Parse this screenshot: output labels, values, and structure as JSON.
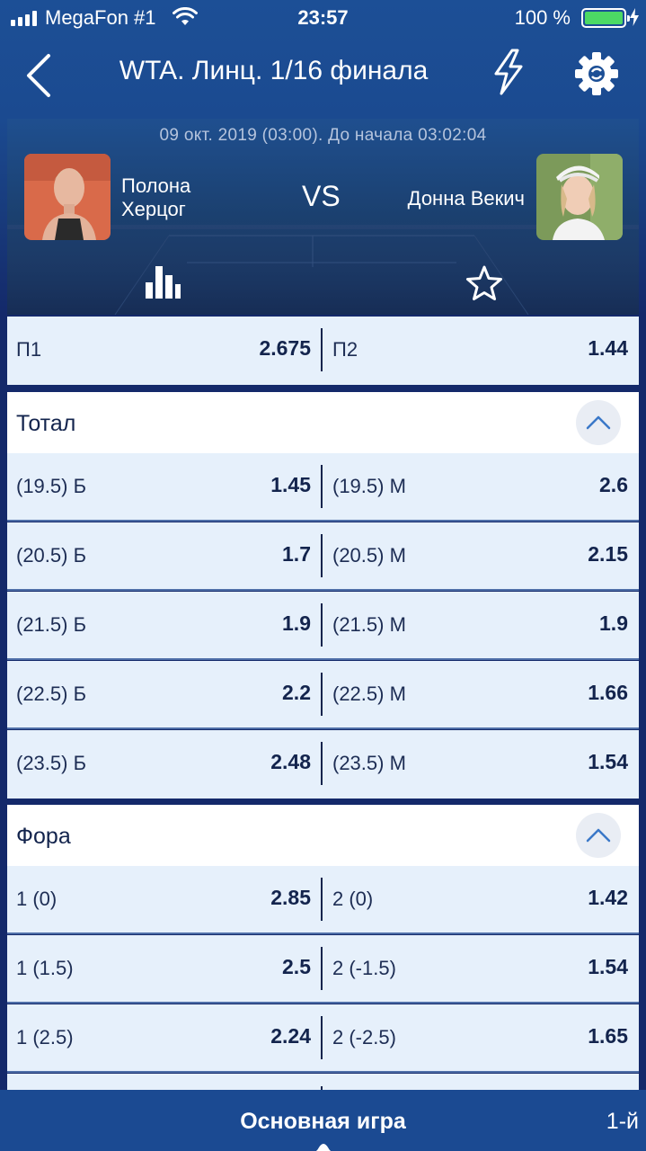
{
  "status_bar": {
    "carrier": "MegaFon #1",
    "time": "23:57",
    "battery": "100 %"
  },
  "header": {
    "title": "WTA. Линц. 1/16 финала"
  },
  "match": {
    "datetime": "09 окт. 2019 (03:00). До начала   03:02:04",
    "player1": "Полона Херцог",
    "player2": "Донна Векич",
    "vs": "VS"
  },
  "winner": {
    "left_label": "П1",
    "left_odd": "2.675",
    "right_label": "П2",
    "right_odd": "1.44"
  },
  "total": {
    "title": "Тотал",
    "rows": [
      {
        "left_label": "(19.5) Б",
        "left_odd": "1.45",
        "right_label": "(19.5) М",
        "right_odd": "2.6"
      },
      {
        "left_label": "(20.5) Б",
        "left_odd": "1.7",
        "right_label": "(20.5) М",
        "right_odd": "2.15"
      },
      {
        "left_label": "(21.5) Б",
        "left_odd": "1.9",
        "right_label": "(21.5) М",
        "right_odd": "1.9"
      },
      {
        "left_label": "(22.5) Б",
        "left_odd": "2.2",
        "right_label": "(22.5) М",
        "right_odd": "1.66"
      },
      {
        "left_label": "(23.5) Б",
        "left_odd": "2.48",
        "right_label": "(23.5) М",
        "right_odd": "1.54"
      }
    ]
  },
  "handicap": {
    "title": "Фора",
    "rows": [
      {
        "left_label": "1 (0)",
        "left_odd": "2.85",
        "right_label": "2 (0)",
        "right_odd": "1.42"
      },
      {
        "left_label": "1 (1.5)",
        "left_odd": "2.5",
        "right_label": "2 (-1.5)",
        "right_odd": "1.54"
      },
      {
        "left_label": "1 (2.5)",
        "left_odd": "2.24",
        "right_label": "2 (-2.5)",
        "right_odd": "1.65"
      }
    ]
  },
  "bottom_tabs": {
    "main": "Основная игра",
    "next": "1-й"
  },
  "colors": {
    "brand_blue": "#1b4a92",
    "row_bg": "#e6f0fb",
    "text_dark": "#13244d",
    "battery_green": "#4cd964"
  },
  "icons": [
    "back-chevron-icon",
    "lightning-icon",
    "gear-icon",
    "bar-chart-icon",
    "star-icon",
    "chevron-up-icon"
  ]
}
